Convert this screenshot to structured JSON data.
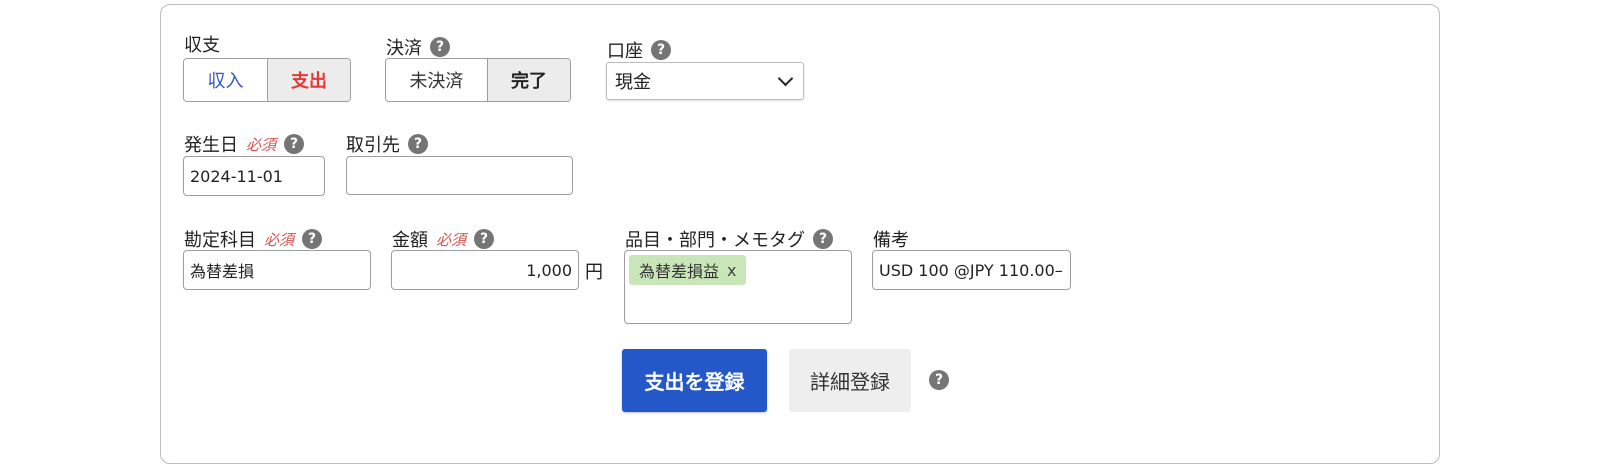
{
  "type_section": {
    "label": "収支",
    "options": [
      "収入",
      "支出"
    ],
    "selected": "支出"
  },
  "settlement": {
    "label": "決済",
    "options": [
      "未決済",
      "完了"
    ],
    "selected": "完了"
  },
  "account": {
    "label": "口座",
    "value": "現金"
  },
  "date": {
    "label": "発生日",
    "required": "必須",
    "value": "2024-11-01"
  },
  "partner": {
    "label": "取引先",
    "value": ""
  },
  "account_item": {
    "label": "勘定科目",
    "required": "必須",
    "value": "為替差損"
  },
  "amount": {
    "label": "金額",
    "required": "必須",
    "value": "1,000",
    "unit": "円"
  },
  "tags": {
    "label": "品目・部門・メモタグ",
    "items": [
      {
        "name": "為替差損益",
        "remove": "x"
      }
    ]
  },
  "note": {
    "label": "備考",
    "value": "USD 100 @JPY 110.00–"
  },
  "actions": {
    "submit": "支出を登録",
    "detail": "詳細登録"
  },
  "help_glyph": "?",
  "colors": {
    "primary": "#2458c8",
    "expense": "#e53935",
    "income": "#2f57c4",
    "required": "#d9534f",
    "tag_bg": "#c9e6b8"
  },
  "icons": [
    "help-icon",
    "chevron-down-icon",
    "close-icon"
  ]
}
